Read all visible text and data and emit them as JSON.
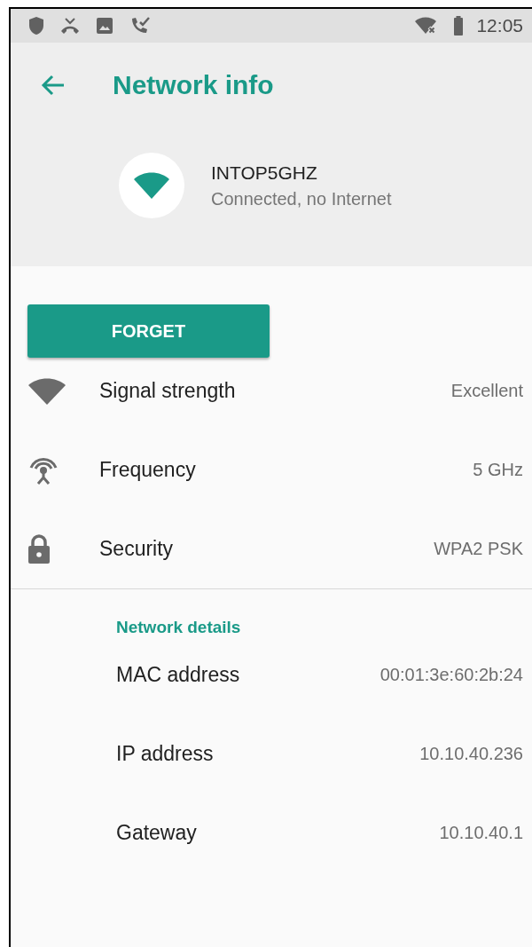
{
  "status_bar": {
    "time": "12:05"
  },
  "header": {
    "title": "Network info"
  },
  "network": {
    "name": "INTOP5GHZ",
    "status": "Connected, no Internet"
  },
  "buttons": [
    {
      "label": "FORGET"
    }
  ],
  "info_rows": [
    {
      "kind": "signal",
      "label": "Signal strength",
      "value": "Excellent"
    },
    {
      "kind": "frequency",
      "label": "Frequency",
      "value": "5 GHz"
    },
    {
      "kind": "security",
      "label": "Security",
      "value": "WPA2 PSK"
    }
  ],
  "details": {
    "heading": "Network details",
    "rows": [
      {
        "label": "MAC address",
        "value": "00:01:3e:60:2b:24"
      },
      {
        "label": "IP address",
        "value": "10.10.40.236"
      },
      {
        "label": "Gateway",
        "value": "10.10.40.1"
      }
    ]
  }
}
